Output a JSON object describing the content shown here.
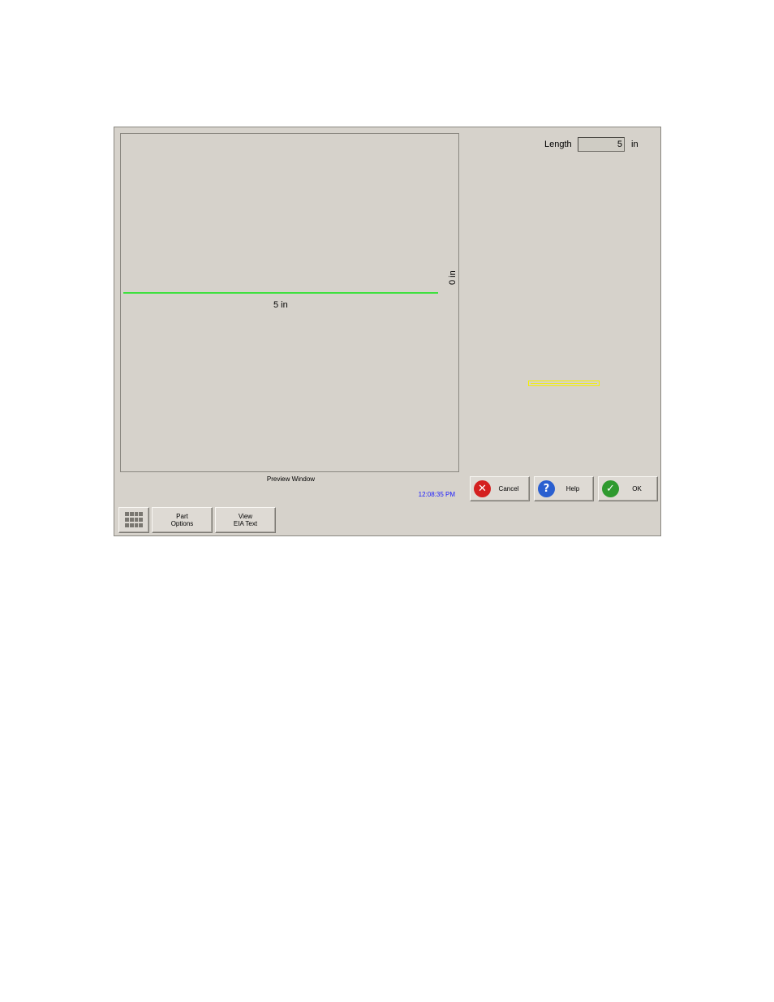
{
  "preview": {
    "dimension_length": "5 in",
    "dimension_zero": "0 in",
    "caption": "Preview Window"
  },
  "status": {
    "clock": "12:08:35 PM"
  },
  "length_field": {
    "label": "Length",
    "value": "5",
    "unit": "in"
  },
  "buttons": {
    "cancel": "Cancel",
    "help": "Help",
    "ok": "OK",
    "part_options": "Part\nOptions",
    "view_eia": "View\nEIA Text"
  },
  "icons": {
    "cancel": "x-circle-icon",
    "help": "question-circle-icon",
    "ok": "checkmark-circle-icon",
    "keypad": "keypad-icon"
  },
  "colors": {
    "part_line": "#3ee03e",
    "part_thumbnail": "#f4f000",
    "clock": "#1a1aff",
    "cancel": "#d42020",
    "help": "#2a5fd0",
    "ok": "#2f9a2f"
  }
}
